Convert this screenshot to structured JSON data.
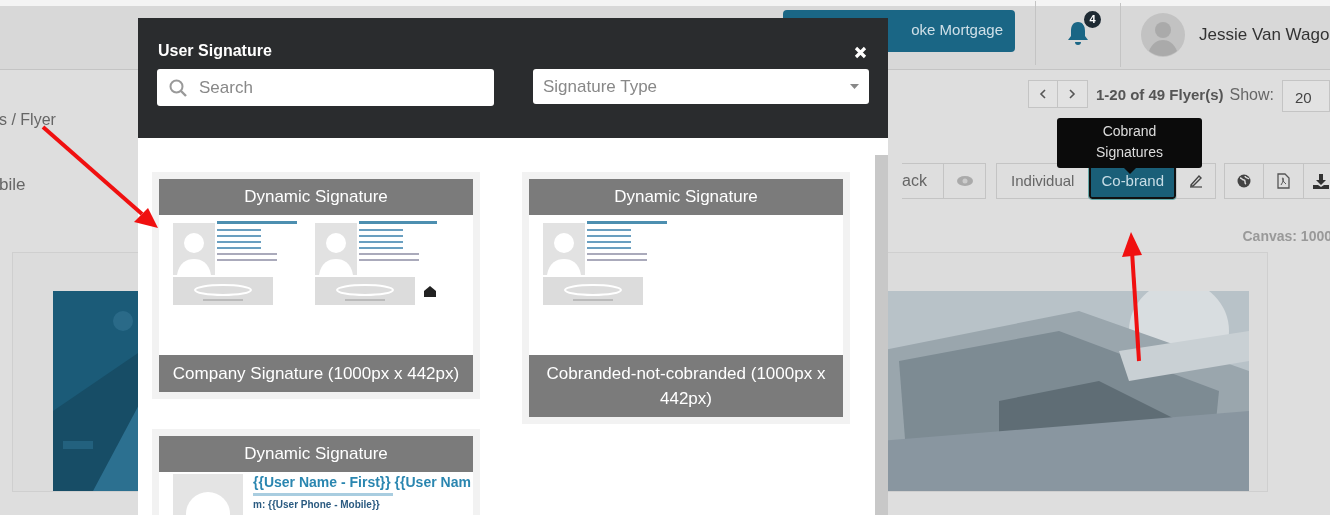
{
  "app_header": {
    "primary_button": "oke Mortgage",
    "notification_count": "4",
    "user_name": "Jessie Van Wago"
  },
  "breadcrumb": "s / Flyer",
  "pagination": {
    "range": "1-20 of 49 Flyer(s)",
    "show_label": "Show:",
    "page_size": "20"
  },
  "side_text": "bile",
  "toolbar": {
    "back": "ack",
    "modes": [
      {
        "label": "Individual",
        "selected": false
      },
      {
        "label": "Co-brand",
        "selected": true
      }
    ]
  },
  "tooltip": "Cobrand Signatures",
  "canvas_label": "Canvas: 1000",
  "modal": {
    "title": "User Signature",
    "search_placeholder": "Search",
    "type_placeholder": "Signature Type",
    "cards": [
      {
        "heading": "Dynamic Signature",
        "kind": "cobrand",
        "caption": "Company Signature (1000px x 442px)"
      },
      {
        "heading": "Dynamic Signature",
        "kind": "single",
        "caption": "Cobranded-not-cobranded (1000px x 442px)"
      },
      {
        "heading": "Dynamic Signature",
        "kind": "large",
        "preview_lines": [
          "{{User Name - First}} {{User Nam",
          "m: {{User Phone - Mobile}}"
        ]
      }
    ]
  }
}
